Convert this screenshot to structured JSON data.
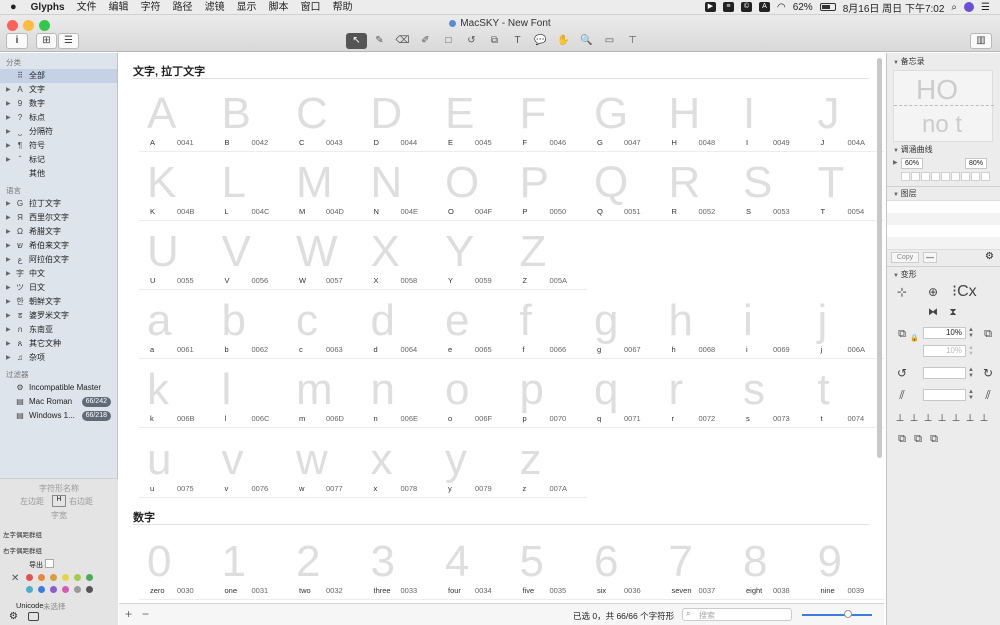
{
  "menubar": {
    "apple": "",
    "app": "Glyphs",
    "items": [
      "文件",
      "编辑",
      "字符",
      "路径",
      "滤镜",
      "显示",
      "脚本",
      "窗口",
      "帮助"
    ],
    "battery": "62%",
    "datetime": "8月16日 周日 下午7:02"
  },
  "window": {
    "title": "MacSKY - New Font"
  },
  "toolbar": {
    "info": "i",
    "grid": "⊞",
    "list": "☰",
    "tools": [
      {
        "name": "select-tool",
        "glyph": "↖",
        "active": true
      },
      {
        "name": "draw-tool",
        "glyph": "✎"
      },
      {
        "name": "eraser-tool",
        "glyph": "⌫"
      },
      {
        "name": "pencil-tool",
        "glyph": "✐"
      },
      {
        "name": "rectangle-tool",
        "glyph": "□"
      },
      {
        "name": "rotate-tool",
        "glyph": "↺"
      },
      {
        "name": "scale-tool",
        "glyph": "⧉"
      },
      {
        "name": "text-tool",
        "glyph": "T"
      },
      {
        "name": "annotation-tool",
        "glyph": "💬"
      },
      {
        "name": "hand-tool",
        "glyph": "✋"
      },
      {
        "name": "zoom-tool",
        "glyph": "🔍"
      },
      {
        "name": "measure-tool",
        "glyph": "▭"
      },
      {
        "name": "extra-tool",
        "glyph": "⊤"
      }
    ],
    "sidebar_toggle": "▥"
  },
  "sidebar": {
    "categories_header": "分类",
    "categories": [
      {
        "icon": "⠿",
        "label": "全部",
        "sel": true
      },
      {
        "icon": "A",
        "label": "文字",
        "tri": true
      },
      {
        "icon": "9",
        "label": "数字",
        "tri": true
      },
      {
        "icon": "?",
        "label": "标点",
        "tri": true
      },
      {
        "icon": "⎵",
        "label": "分隔符",
        "tri": true
      },
      {
        "icon": "¶",
        "label": "符号",
        "tri": true
      },
      {
        "icon": "ˆ",
        "label": "标记",
        "tri": true
      },
      {
        "icon": "",
        "label": "其他"
      }
    ],
    "languages_header": "语言",
    "languages": [
      {
        "icon": "G",
        "label": "拉丁文字"
      },
      {
        "icon": "Я",
        "label": "西里尔文字"
      },
      {
        "icon": "Ω",
        "label": "希腊文字"
      },
      {
        "icon": "ש",
        "label": "希伯来文字"
      },
      {
        "icon": "ﻉ",
        "label": "阿拉伯文字"
      },
      {
        "icon": "字",
        "label": "中文"
      },
      {
        "icon": "ツ",
        "label": "日文"
      },
      {
        "icon": "한",
        "label": "朝鲜文字"
      },
      {
        "icon": "ड",
        "label": "婆罗米文字"
      },
      {
        "icon": "ก",
        "label": "东南亚"
      },
      {
        "icon": "ጰ",
        "label": "其它文种"
      },
      {
        "icon": "♫",
        "label": "杂项"
      }
    ],
    "filters_header": "过滤器",
    "filters": [
      {
        "icon": "⚙",
        "label": "Incompatible Master"
      },
      {
        "icon": "▤",
        "label": "Mac Roman",
        "badge": "66/242"
      },
      {
        "icon": "▤",
        "label": "Windows 1...",
        "badge": "66/218"
      }
    ],
    "bottom": {
      "glyph_name": "字符形名称",
      "left_sb": "左边距",
      "right_sb": "右边距",
      "width": "字宽",
      "left_kern": "左字偶距群组",
      "right_kern": "右字偶距群组",
      "export": "导出",
      "unicode_label": "Unicode",
      "unicode_value": "未选择"
    }
  },
  "main": {
    "section1_title": "文字, 拉丁文字",
    "section2_title": "数字",
    "glyphs": [
      {
        "g": "A",
        "n": "A",
        "u": "0041"
      },
      {
        "g": "B",
        "n": "B",
        "u": "0042"
      },
      {
        "g": "C",
        "n": "C",
        "u": "0043"
      },
      {
        "g": "D",
        "n": "D",
        "u": "0044"
      },
      {
        "g": "E",
        "n": "E",
        "u": "0045"
      },
      {
        "g": "F",
        "n": "F",
        "u": "0046"
      },
      {
        "g": "G",
        "n": "G",
        "u": "0047"
      },
      {
        "g": "H",
        "n": "H",
        "u": "0048"
      },
      {
        "g": "I",
        "n": "I",
        "u": "0049"
      },
      {
        "g": "J",
        "n": "J",
        "u": "004A"
      },
      {
        "g": "K",
        "n": "K",
        "u": "004B"
      },
      {
        "g": "L",
        "n": "L",
        "u": "004C"
      },
      {
        "g": "M",
        "n": "M",
        "u": "004D"
      },
      {
        "g": "N",
        "n": "N",
        "u": "004E"
      },
      {
        "g": "O",
        "n": "O",
        "u": "004F"
      },
      {
        "g": "P",
        "n": "P",
        "u": "0050"
      },
      {
        "g": "Q",
        "n": "Q",
        "u": "0051"
      },
      {
        "g": "R",
        "n": "R",
        "u": "0052"
      },
      {
        "g": "S",
        "n": "S",
        "u": "0053"
      },
      {
        "g": "T",
        "n": "T",
        "u": "0054"
      },
      {
        "g": "U",
        "n": "U",
        "u": "0055"
      },
      {
        "g": "V",
        "n": "V",
        "u": "0056"
      },
      {
        "g": "W",
        "n": "W",
        "u": "0057"
      },
      {
        "g": "X",
        "n": "X",
        "u": "0058"
      },
      {
        "g": "Y",
        "n": "Y",
        "u": "0059"
      },
      {
        "g": "Z",
        "n": "Z",
        "u": "005A"
      },
      {
        "g": "a",
        "n": "a",
        "u": "0061"
      },
      {
        "g": "b",
        "n": "b",
        "u": "0062"
      },
      {
        "g": "c",
        "n": "c",
        "u": "0063"
      },
      {
        "g": "d",
        "n": "d",
        "u": "0064"
      },
      {
        "g": "e",
        "n": "e",
        "u": "0065"
      },
      {
        "g": "f",
        "n": "f",
        "u": "0066"
      },
      {
        "g": "g",
        "n": "g",
        "u": "0067"
      },
      {
        "g": "h",
        "n": "h",
        "u": "0068"
      },
      {
        "g": "i",
        "n": "i",
        "u": "0069"
      },
      {
        "g": "j",
        "n": "j",
        "u": "006A"
      },
      {
        "g": "k",
        "n": "k",
        "u": "006B"
      },
      {
        "g": "l",
        "n": "l",
        "u": "006C"
      },
      {
        "g": "m",
        "n": "m",
        "u": "006D"
      },
      {
        "g": "n",
        "n": "n",
        "u": "006E"
      },
      {
        "g": "o",
        "n": "o",
        "u": "006F"
      },
      {
        "g": "p",
        "n": "p",
        "u": "0070"
      },
      {
        "g": "q",
        "n": "q",
        "u": "0071"
      },
      {
        "g": "r",
        "n": "r",
        "u": "0072"
      },
      {
        "g": "s",
        "n": "s",
        "u": "0073"
      },
      {
        "g": "t",
        "n": "t",
        "u": "0074"
      },
      {
        "g": "u",
        "n": "u",
        "u": "0075"
      },
      {
        "g": "v",
        "n": "v",
        "u": "0076"
      },
      {
        "g": "w",
        "n": "w",
        "u": "0077"
      },
      {
        "g": "x",
        "n": "x",
        "u": "0078"
      },
      {
        "g": "y",
        "n": "y",
        "u": "0079"
      },
      {
        "g": "z",
        "n": "z",
        "u": "007A"
      }
    ],
    "figures": [
      {
        "g": "0",
        "n": "zero",
        "u": "0030"
      },
      {
        "g": "1",
        "n": "one",
        "u": "0031"
      },
      {
        "g": "2",
        "n": "two",
        "u": "0032"
      },
      {
        "g": "3",
        "n": "three",
        "u": "0033"
      },
      {
        "g": "4",
        "n": "four",
        "u": "0034"
      },
      {
        "g": "5",
        "n": "five",
        "u": "0035"
      },
      {
        "g": "6",
        "n": "six",
        "u": "0036"
      },
      {
        "g": "7",
        "n": "seven",
        "u": "0037"
      },
      {
        "g": "8",
        "n": "eight",
        "u": "0038"
      },
      {
        "g": "9",
        "n": "nine",
        "u": "0039"
      }
    ]
  },
  "statusbar": {
    "add": "+",
    "remove": "−",
    "status": "已选 0，共 66/66 个字符形",
    "search_placeholder": "搜索"
  },
  "right": {
    "notes_header": "备忘录",
    "preview_top": "HO",
    "preview_bottom": "no t",
    "curves_header": "调涵曲线",
    "curve_left": "60%",
    "curve_right": "80%",
    "layers_header": "图层",
    "copy": "Copy",
    "transform_header": "变形",
    "scale_value": "10%",
    "scale_value2": "10%",
    "cx_label": "Cx"
  },
  "colors": {
    "accent": "#3b7cdc",
    "label_colors": [
      "#e05252",
      "#e8873a",
      "#d4a03a",
      "#e4d446",
      "#a4cc4a",
      "#4caa58",
      "#4ab0c8",
      "#3b7cdc",
      "#8a5cd4",
      "#d65ab4",
      "#9a9a9a",
      "#555555"
    ]
  }
}
